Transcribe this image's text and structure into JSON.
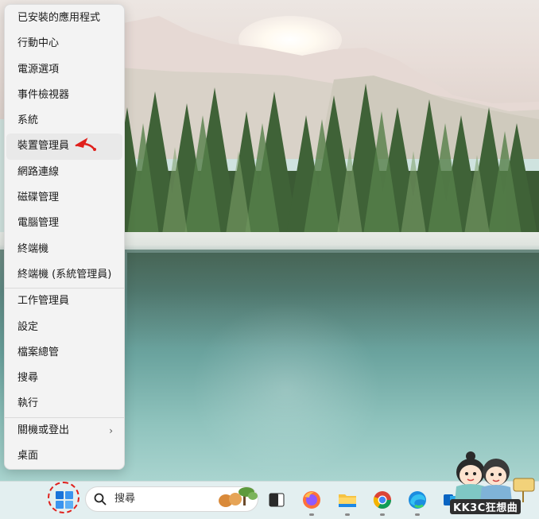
{
  "start_menu": {
    "items": [
      {
        "label": "已安裝的應用程式"
      },
      {
        "label": "行動中心"
      },
      {
        "label": "電源選項"
      },
      {
        "label": "事件檢視器"
      },
      {
        "label": "系統"
      },
      {
        "label": "裝置管理員",
        "highlighted": true
      },
      {
        "label": "網路連線"
      },
      {
        "label": "磁碟管理"
      },
      {
        "label": "電腦管理"
      },
      {
        "label": "終端機"
      },
      {
        "label": "終端機 (系統管理員)"
      },
      {
        "label": "工作管理員"
      },
      {
        "label": "設定"
      },
      {
        "label": "檔案總管"
      },
      {
        "label": "搜尋"
      },
      {
        "label": "執行"
      },
      {
        "label": "關機或登出",
        "has_submenu": true
      },
      {
        "label": "桌面"
      }
    ],
    "submenu_chevron": "›"
  },
  "taskbar": {
    "search_placeholder": "搜尋",
    "apps": [
      "windows-start-icon",
      "task-view-icon",
      "firefox-icon",
      "file-explorer-icon",
      "chrome-icon",
      "edge-icon",
      "outlook-icon"
    ]
  },
  "watermark": {
    "text": "KK3C狂想曲"
  },
  "colors": {
    "annotation_red": "#e0201c",
    "menu_bg": "#f3f3f3",
    "taskbar_bg": "#e3eff0"
  }
}
